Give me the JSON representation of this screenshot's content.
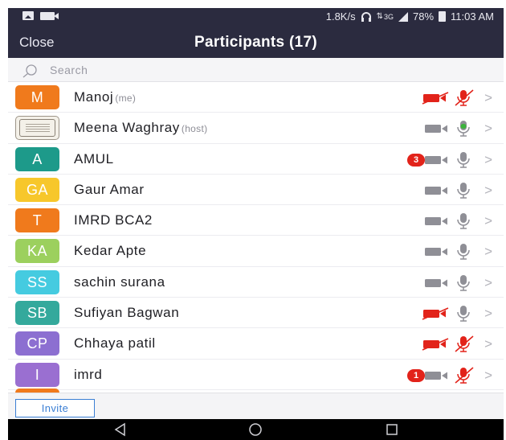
{
  "status_bar": {
    "speed": "1.8K/s",
    "network": "3G",
    "battery": "78%",
    "time": "11:03 AM"
  },
  "header": {
    "close_label": "Close",
    "title": "Participants (17)"
  },
  "search": {
    "placeholder": "Search"
  },
  "participants": [
    {
      "name": "Manoj",
      "tag": "(me)",
      "initials": "M",
      "avatar_color": "#f07a1c",
      "video_on": false,
      "audio": "muted",
      "badge": ""
    },
    {
      "name": "Meena Waghray",
      "tag": "(host)",
      "initials": "",
      "avatar_color": "",
      "video_on": true,
      "audio": "speaking",
      "badge": ""
    },
    {
      "name": "AMUL",
      "tag": "",
      "initials": "A",
      "avatar_color": "#1d9a8a",
      "video_on": true,
      "audio": "on",
      "badge": "3"
    },
    {
      "name": "Gaur Amar",
      "tag": "",
      "initials": "GA",
      "avatar_color": "#f7c72b",
      "video_on": true,
      "audio": "on",
      "badge": ""
    },
    {
      "name": "IMRD BCA2",
      "tag": "",
      "initials": "T",
      "avatar_color": "#f07a1c",
      "video_on": true,
      "audio": "on",
      "badge": ""
    },
    {
      "name": "Kedar Apte",
      "tag": "",
      "initials": "KA",
      "avatar_color": "#9cd05e",
      "video_on": true,
      "audio": "on",
      "badge": ""
    },
    {
      "name": "sachin surana",
      "tag": "",
      "initials": "SS",
      "avatar_color": "#45cbe0",
      "video_on": true,
      "audio": "on",
      "badge": ""
    },
    {
      "name": "Sufiyan Bagwan",
      "tag": "",
      "initials": "SB",
      "avatar_color": "#34a99c",
      "video_on": false,
      "audio": "on",
      "badge": ""
    },
    {
      "name": "Chhaya patil",
      "tag": "",
      "initials": "CP",
      "avatar_color": "#8c6fd1",
      "video_on": false,
      "audio": "muted",
      "badge": ""
    },
    {
      "name": "imrd",
      "tag": "",
      "initials": "I",
      "avatar_color": "#9a6fd1",
      "video_on": true,
      "audio": "muted",
      "badge": "1"
    }
  ],
  "footer": {
    "invite_label": "Invite"
  },
  "colors": {
    "header_bg": "#2b2b3f",
    "muted_red": "#e2231a",
    "speaking_green": "#3cb43c",
    "icon_gray": "#8f8f96",
    "accent_blue": "#3b7fd4"
  }
}
